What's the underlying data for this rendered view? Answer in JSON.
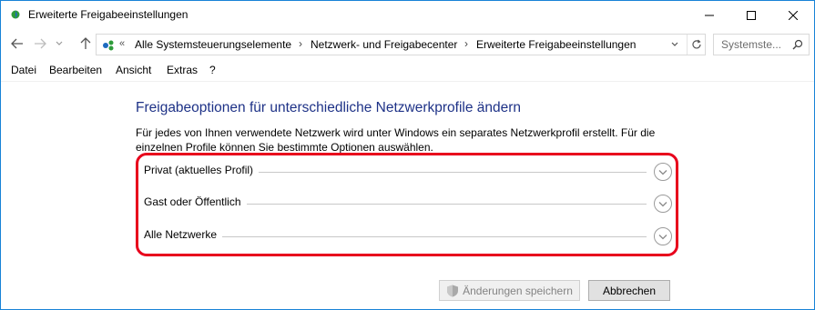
{
  "window": {
    "title": "Erweiterte Freigabeeinstellungen"
  },
  "address_bar": {
    "overflow": "«",
    "breadcrumbs": [
      "Alle Systemsteuerungselemente",
      "Netzwerk- und Freigabecenter",
      "Erweiterte Freigabeeinstellungen"
    ],
    "separator": "›"
  },
  "search": {
    "placeholder": "Systemste..."
  },
  "menu": {
    "items": [
      "Datei",
      "Bearbeiten",
      "Ansicht",
      "Extras",
      "?"
    ]
  },
  "main": {
    "heading": "Freigabeoptionen für unterschiedliche Netzwerkprofile ändern",
    "description": "Für jedes von Ihnen verwendete Netzwerk wird unter Windows ein separates Netzwerkprofil erstellt. Für die einzelnen Profile können Sie bestimmte Optionen auswählen.",
    "profiles": [
      {
        "label": "Privat (aktuelles Profil)"
      },
      {
        "label": "Gast oder Öffentlich"
      },
      {
        "label": "Alle Netzwerke"
      }
    ]
  },
  "footer": {
    "save_label": "Änderungen speichern",
    "cancel_label": "Abbrechen"
  },
  "colors": {
    "heading": "#1e3287",
    "highlight": "#e8001c",
    "window_border": "#1883d7"
  },
  "icons": {
    "app": "network-icon",
    "minimize": "minimize-icon",
    "maximize": "maximize-icon",
    "close": "close-icon",
    "back": "arrow-left-icon",
    "forward": "arrow-right-icon",
    "recent": "chevron-down-icon",
    "up": "arrow-up-icon",
    "refresh": "refresh-icon",
    "search": "search-icon",
    "expand": "chevron-down-icon",
    "shield": "uac-shield-icon"
  }
}
